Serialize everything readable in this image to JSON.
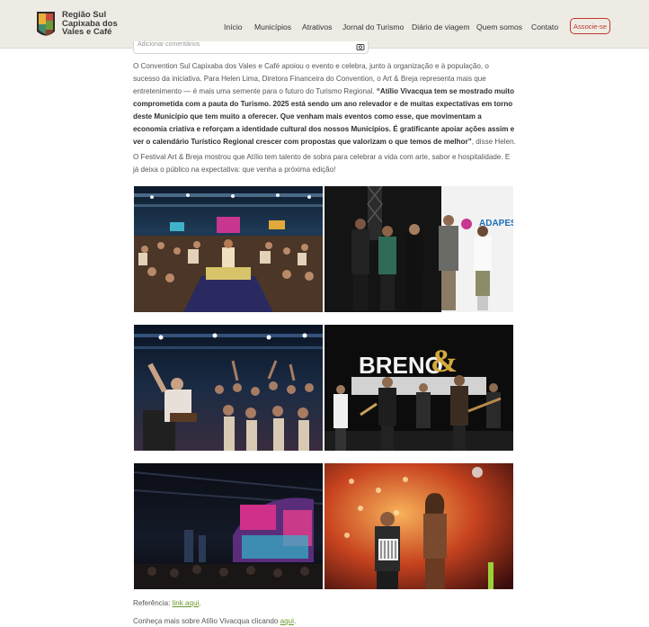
{
  "header": {
    "brand_lines": [
      "Região Sul",
      "Capixaba dos",
      "Vales e Café"
    ],
    "nav": [
      "Início",
      "Municípios",
      "Atrativos",
      "Jornal do Turismo",
      "Diário de viagem",
      "Quem somos",
      "Contato"
    ],
    "cta": "Associe-se"
  },
  "partial_field": {
    "text": "Adicionar comentários",
    "icon": "camera-icon"
  },
  "article": {
    "p1_plain": "O Convention Sul Capixaba dos Vales e Café apoiou o evento e celebra, junto à organização e à população, o sucesso da iniciativa. Para Helen Lima, Diretora Financeira do Convention, o Art & Breja representa mais que entretenimento — é mais uma semente para o futuro do Turismo Regional.",
    "p1_bold": "“Atílio Vivacqua tem se mostrado muito comprometida com a pauta do Turismo. 2025 está sendo um ano relevador e de muitas expectativas em torno deste Município que tem muito a oferecer. Que venham mais eventos como esse, que movimentam a economia criativa e reforçam a identidade cultural dos nossos Municípios. É gratificante apoiar ações assim e ver o calendário Turístico Regional crescer com propostas que valorizam o que temos de melhor”",
    "p1_tail": ", disse Helen.",
    "p2": "O Festival Art & Breja mostrou que Atílio tem talento de sobra para celebrar a vida com arte, sabor e hospitalidade. E já deixa o público na expectativa: que venha a próxima edição!",
    "photo_texts": {
      "breno": "BRENO",
      "amp": "&",
      "adapt": "ADAPES"
    },
    "ref_label": "Referência: ",
    "ref_link": "link aqui",
    "ref_end": ".",
    "more_label": "Conheça mais sobre Atílio Vivacqua clicando ",
    "more_link": "aqui",
    "more_end": "."
  },
  "colors": {
    "accent_red": "#c0392b",
    "link_green": "#6a9a2a",
    "header_bg": "#edebe4"
  }
}
